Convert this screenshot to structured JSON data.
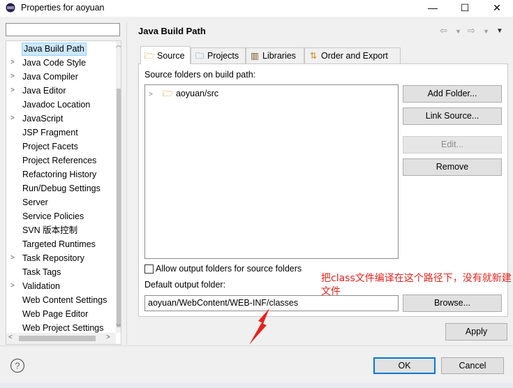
{
  "window": {
    "title": "Properties for aoyuan",
    "minimize_glyph": "—",
    "maximize_glyph": "☐",
    "close_glyph": "✕"
  },
  "filter": {
    "value": "",
    "placeholder": ""
  },
  "nav": {
    "items": [
      {
        "label": "Java Build Path",
        "expandable": false,
        "selected": true
      },
      {
        "label": "Java Code Style",
        "expandable": true
      },
      {
        "label": "Java Compiler",
        "expandable": true
      },
      {
        "label": "Java Editor",
        "expandable": true
      },
      {
        "label": "Javadoc Location",
        "expandable": false
      },
      {
        "label": "JavaScript",
        "expandable": true
      },
      {
        "label": "JSP Fragment",
        "expandable": false
      },
      {
        "label": "Project Facets",
        "expandable": false
      },
      {
        "label": "Project References",
        "expandable": false
      },
      {
        "label": "Refactoring History",
        "expandable": false
      },
      {
        "label": "Run/Debug Settings",
        "expandable": false
      },
      {
        "label": "Server",
        "expandable": false
      },
      {
        "label": "Service Policies",
        "expandable": false
      },
      {
        "label": "SVN 版本控制",
        "expandable": false
      },
      {
        "label": "Targeted Runtimes",
        "expandable": false
      },
      {
        "label": "Task Repository",
        "expandable": true
      },
      {
        "label": "Task Tags",
        "expandable": false
      },
      {
        "label": "Validation",
        "expandable": true
      },
      {
        "label": "Web Content Settings",
        "expandable": false
      },
      {
        "label": "Web Page Editor",
        "expandable": false
      },
      {
        "label": "Web Project Settings",
        "expandable": false
      }
    ]
  },
  "page": {
    "title": "Java Build Path"
  },
  "tabs": [
    {
      "label": "Source",
      "icon": "source-folder-icon",
      "active": true
    },
    {
      "label": "Projects",
      "icon": "projects-icon",
      "active": false
    },
    {
      "label": "Libraries",
      "icon": "libraries-icon",
      "active": false
    },
    {
      "label": "Order and Export",
      "icon": "order-export-icon",
      "active": false
    }
  ],
  "source": {
    "section_label": "Source folders on build path:",
    "tree_items": [
      {
        "label": "aoyuan/src",
        "icon": "package-folder-icon"
      }
    ],
    "buttons": {
      "add_folder": "Add Folder...",
      "link_source": "Link Source...",
      "edit": "Edit...",
      "remove": "Remove"
    },
    "allow_output_label": "Allow output folders for source folders",
    "allow_output_checked": false,
    "default_output_label": "Default output folder:",
    "default_output_value": "aoyuan/WebContent/WEB-INF/classes",
    "browse": "Browse..."
  },
  "annotation": {
    "text": "把class文件编译在这个路径下，没有就新建文件",
    "color": "#e8221b"
  },
  "footer": {
    "apply": "Apply",
    "ok": "OK",
    "cancel": "Cancel"
  }
}
